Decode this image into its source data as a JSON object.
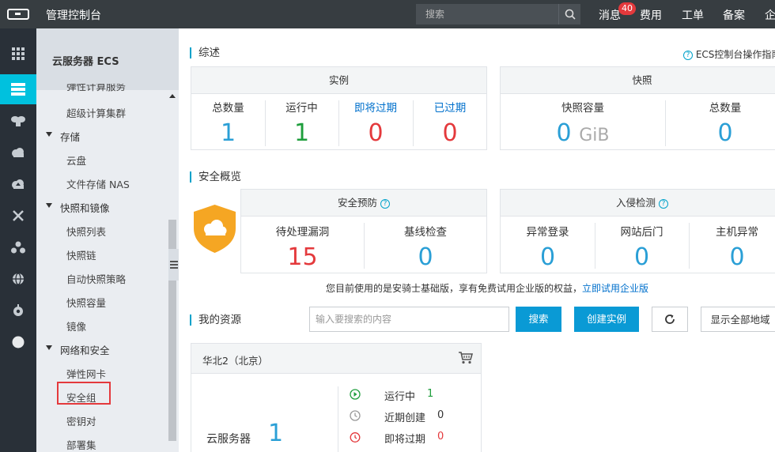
{
  "topbar": {
    "title": "管理控制台",
    "search_placeholder": "搜索",
    "nav": [
      "消息",
      "费用",
      "工单",
      "备案",
      "企"
    ],
    "message_badge": "40"
  },
  "rail": {
    "icons": [
      "grid-icon",
      "server-icon",
      "brain-icon",
      "cloud-icon",
      "cloud-upload-icon",
      "network-icon",
      "cluster-icon",
      "globe-icon",
      "settings-icon",
      "circle-icon"
    ],
    "active_index": 1
  },
  "sidebar": {
    "title": "云服务器 ECS",
    "cut_item": "弹性计算服务",
    "items": [
      {
        "label": "超级计算集群",
        "type": "child"
      },
      {
        "label": "存储",
        "type": "group"
      },
      {
        "label": "云盘",
        "type": "child"
      },
      {
        "label": "文件存储 NAS",
        "type": "child"
      },
      {
        "label": "快照和镜像",
        "type": "group"
      },
      {
        "label": "快照列表",
        "type": "child"
      },
      {
        "label": "快照链",
        "type": "child"
      },
      {
        "label": "自动快照策略",
        "type": "child"
      },
      {
        "label": "快照容量",
        "type": "child"
      },
      {
        "label": "镜像",
        "type": "child"
      },
      {
        "label": "网络和安全",
        "type": "group"
      },
      {
        "label": "弹性网卡",
        "type": "child"
      },
      {
        "label": "安全组",
        "type": "child"
      },
      {
        "label": "密钥对",
        "type": "child"
      },
      {
        "label": "部署集",
        "type": "child"
      }
    ],
    "selected": "安全组"
  },
  "overview": {
    "title": "综述",
    "guide_link": "ECS控制台操作指南",
    "instances": {
      "header": "实例",
      "metrics": [
        {
          "label": "总数量",
          "value": "1",
          "color": "#2a9fd6",
          "link": false
        },
        {
          "label": "运行中",
          "value": "1",
          "color": "#1e9e3c",
          "link": false
        },
        {
          "label": "即将过期",
          "value": "0",
          "color": "#e4393c",
          "link": true
        },
        {
          "label": "已过期",
          "value": "0",
          "color": "#e4393c",
          "link": true
        }
      ]
    },
    "snapshots": {
      "header": "快照",
      "metrics": [
        {
          "label": "快照容量",
          "value": "0",
          "unit": "GiB",
          "color": "#2a9fd6"
        },
        {
          "label": "总数量",
          "value": "0",
          "color": "#2a9fd6"
        }
      ]
    }
  },
  "security": {
    "title": "安全概览",
    "prevention": {
      "header": "安全预防",
      "metrics": [
        {
          "label": "待处理漏洞",
          "value": "15",
          "color": "#e4393c"
        },
        {
          "label": "基线检查",
          "value": "0",
          "color": "#2a9fd6"
        }
      ]
    },
    "intrusion": {
      "header": "入侵检测",
      "metrics": [
        {
          "label": "异常登录",
          "value": "0",
          "color": "#2a9fd6"
        },
        {
          "label": "网站后门",
          "value": "0",
          "color": "#2a9fd6"
        },
        {
          "label": "主机异常",
          "value": "0",
          "color": "#2a9fd6"
        }
      ]
    },
    "notice": "您目前使用的是安骑士基础版，享有免费试用企业版的权益，",
    "notice_link": "立即试用企业版"
  },
  "resources": {
    "title": "我的资源",
    "search_placeholder": "输入要搜索的内容",
    "search_button": "搜索",
    "create_button": "创建实例",
    "show_all_button": "显示全部地域",
    "region_card": {
      "region": "华北2（北京）",
      "service": "云服务器",
      "count": "1",
      "statuses": [
        {
          "label": "运行中",
          "value": "1",
          "color": "#1e9e3c"
        },
        {
          "label": "近期创建",
          "value": "0",
          "color": "#333333"
        },
        {
          "label": "即将过期",
          "value": "0",
          "color": "#e4393c"
        }
      ]
    }
  }
}
